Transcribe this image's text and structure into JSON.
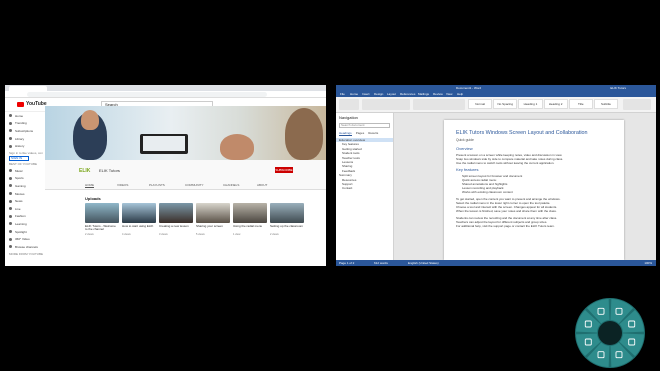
{
  "youtube": {
    "logo_text": "YouTube",
    "search_placeholder": "Search",
    "sidebar": [
      "Home",
      "Trending",
      "Subscriptions",
      "Library",
      "History"
    ],
    "sign_in_prompt": "Sign in to like videos, comment, and subscribe.",
    "sign_in_label": "SIGN IN",
    "best_section": "BEST OF YOUTUBE",
    "best": [
      "Music",
      "Sports",
      "Gaming",
      "Movies",
      "News",
      "Live",
      "Fashion",
      "Learning",
      "Spotlight",
      "360° Video"
    ],
    "browse_label": "Browse channels",
    "more_section": "MORE FROM YOUTUBE",
    "channel_logo": "ELIK",
    "channel_name": "ELIK Tutors",
    "subscribe_label": "SUBSCRIBE",
    "channel_tabs": [
      "HOME",
      "VIDEOS",
      "PLAYLISTS",
      "COMMUNITY",
      "CHANNELS",
      "ABOUT"
    ],
    "uploads_label": "Uploads",
    "videos": [
      {
        "title": "ELIK Tutors - Welcome to the channel",
        "meta": "2 views"
      },
      {
        "title": "How to start using ELIK",
        "meta": "4 views"
      },
      {
        "title": "Creating a new lesson",
        "meta": "3 views"
      },
      {
        "title": "Sharing your screen",
        "meta": "5 views"
      },
      {
        "title": "Using the radial menu",
        "meta": "1 view"
      },
      {
        "title": "Setting up the classroom",
        "meta": "2 views"
      }
    ]
  },
  "word": {
    "title": "Document1 - Word",
    "user": "ELIK Tutors",
    "menu": [
      "File",
      "Home",
      "Insert",
      "Design",
      "Layout",
      "References",
      "Mailings",
      "Review",
      "View",
      "Help"
    ],
    "styles": [
      "Normal",
      "No Spacing",
      "Heading 1",
      "Heading 2",
      "Title",
      "Subtitle"
    ],
    "nav": {
      "title": "Navigation",
      "search": "Search document",
      "tabs": [
        "Headings",
        "Pages",
        "Results"
      ],
      "headings": [
        "Education overview",
        "Key features",
        "Getting started",
        "Student tools",
        "Teacher tools",
        "Lessons",
        "Sharing",
        "Feedback",
        "Summary",
        "Resources",
        "Support",
        "Contact"
      ]
    },
    "doc": {
      "title": "ELIK Tutors Windows Screen Layout and Collaboration",
      "subtitle": "Quick guide",
      "heading": "Overview",
      "lines": [
        "Present a lesson on a screen while keeping notes, video and discussion in view.",
        "Snap two windows side by side to compare material and take notes during class.",
        "Use the radial menu to switch tools without leaving the current application."
      ],
      "heading2": "Key features",
      "bullets": [
        "Split screen layout for browser and document",
        "Quick access radial menu",
        "Shared annotations and highlights",
        "Lesson recording and playback",
        "Works with existing classroom content"
      ],
      "paragraphs": [
        "To get started, open the content you want to present and arrange the windows.",
        "Select the radial menu in the lower right corner to open the tool palette.",
        "Choose a tool and interact with the screen. Changes appear for all students.",
        "When the lesson is finished, save your notes and share them with the class.",
        "Students can review the recording and the document at any time after class.",
        "Teachers can adjust the layout for different subjects and group sizes.",
        "For additional help, visit the support page or contact the ELIK Tutors team."
      ]
    },
    "status": {
      "page": "Page 1 of 2",
      "words": "612 words",
      "language": "English (United States)",
      "zoom": "100%"
    }
  },
  "radial_menu": {
    "icons": [
      "pen-icon",
      "highlighter-icon",
      "eraser-icon",
      "shapes-icon",
      "text-icon",
      "screen-icon",
      "camera-icon",
      "settings-icon"
    ],
    "accent": "#2e8c8c",
    "ring": "#1f6f70"
  }
}
